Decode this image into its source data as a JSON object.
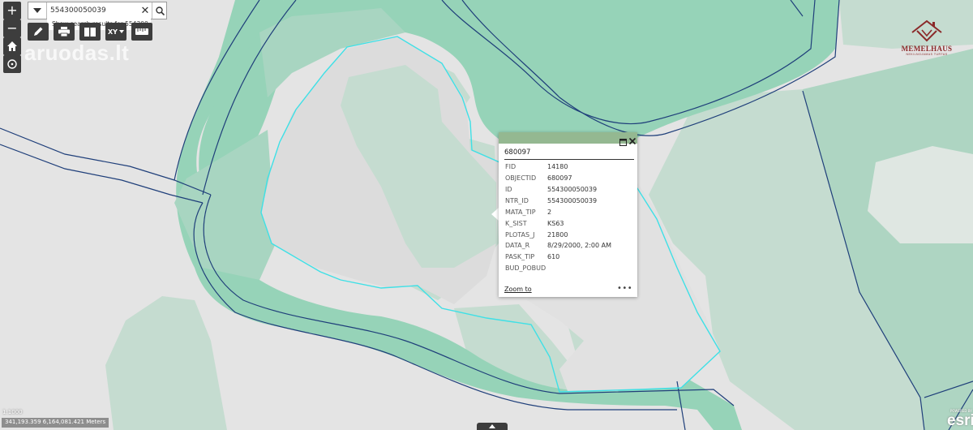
{
  "map": {
    "colors": {
      "background": "#e4e4e4",
      "parcel_light": "#c5dcd0",
      "parcel_mid": "#a9d6c2",
      "parcel_dark": "#96d3b8",
      "boundary": "#1f3f7a",
      "highlight": "#3fe0e6"
    }
  },
  "controls": {
    "zoom_in_label": "+",
    "zoom_out_label": "−",
    "home_icon": "home-icon",
    "locate_icon": "crosshair-icon"
  },
  "search": {
    "value": "554300050039",
    "suggestion": "Show search results for 554300...",
    "clear_label": "✕"
  },
  "toolbar": {
    "xy_label": "XY",
    "tools": [
      "pencil-icon",
      "print-icon",
      "layers-icon",
      "coordinates-icon",
      "measure-icon"
    ]
  },
  "watermark": {
    "text": "aruodas.lt"
  },
  "logo": {
    "name": "MEMELHAUS",
    "sub": "NEKILNOJAMAS TURTAS"
  },
  "popup": {
    "title": "680097",
    "fields": [
      {
        "key": "FID",
        "value": "14180"
      },
      {
        "key": "OBJECTID",
        "value": "680097"
      },
      {
        "key": "ID",
        "value": "554300050039"
      },
      {
        "key": "NTR_ID",
        "value": "554300050039"
      },
      {
        "key": "MATA_TIP",
        "value": "2"
      },
      {
        "key": "K_SIST",
        "value": "KS63"
      },
      {
        "key": "PLOTAS_J",
        "value": "21800"
      },
      {
        "key": "DATA_R",
        "value": "8/29/2000, 2:00 AM"
      },
      {
        "key": "PASK_TIP",
        "value": "610"
      },
      {
        "key": "BUD_POBUD",
        "value": ""
      }
    ],
    "zoom_label": "Zoom to",
    "more_label": "•••"
  },
  "status": {
    "scale": "1:1000",
    "coordinates": "341,193.359 6,164,081.421 Meters"
  },
  "attribution": {
    "powered_by": "POWERED BY",
    "brand": "esri"
  }
}
